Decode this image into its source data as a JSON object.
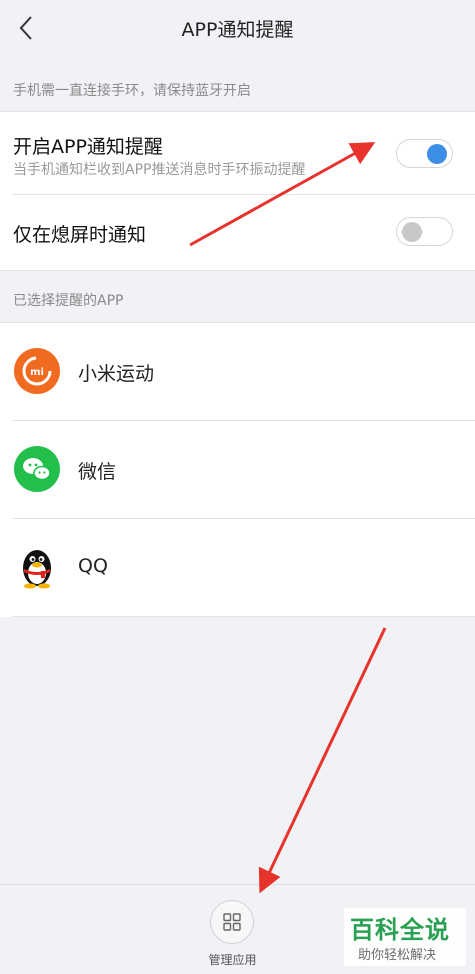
{
  "header": {
    "title": "APP通知提醒",
    "back_icon": "chevron-left-icon"
  },
  "bluetooth_note": "手机需一直连接手环，请保持蓝牙开启",
  "settings": [
    {
      "title": "开启APP通知提醒",
      "desc": "当手机通知栏收到APP推送消息时手环振动提醒",
      "enabled": true,
      "on_color": "#3d8fe6"
    },
    {
      "title": "仅在熄屏时通知",
      "enabled": false,
      "off_color": "#c8c8c8"
    }
  ],
  "selected_apps_header": "已选择提醒的APP",
  "apps": [
    {
      "name": "小米运动",
      "icon": "mi-fit-icon",
      "color": "#f06a20"
    },
    {
      "name": "微信",
      "icon": "wechat-icon",
      "color": "#22c04a"
    },
    {
      "name": "QQ",
      "icon": "qq-penguin-icon",
      "color": "#111111"
    }
  ],
  "bottom": {
    "label": "管理应用",
    "icon": "grid-icon"
  },
  "watermark": {
    "title": "百科全说",
    "subtitle": "助你轻松解决"
  }
}
